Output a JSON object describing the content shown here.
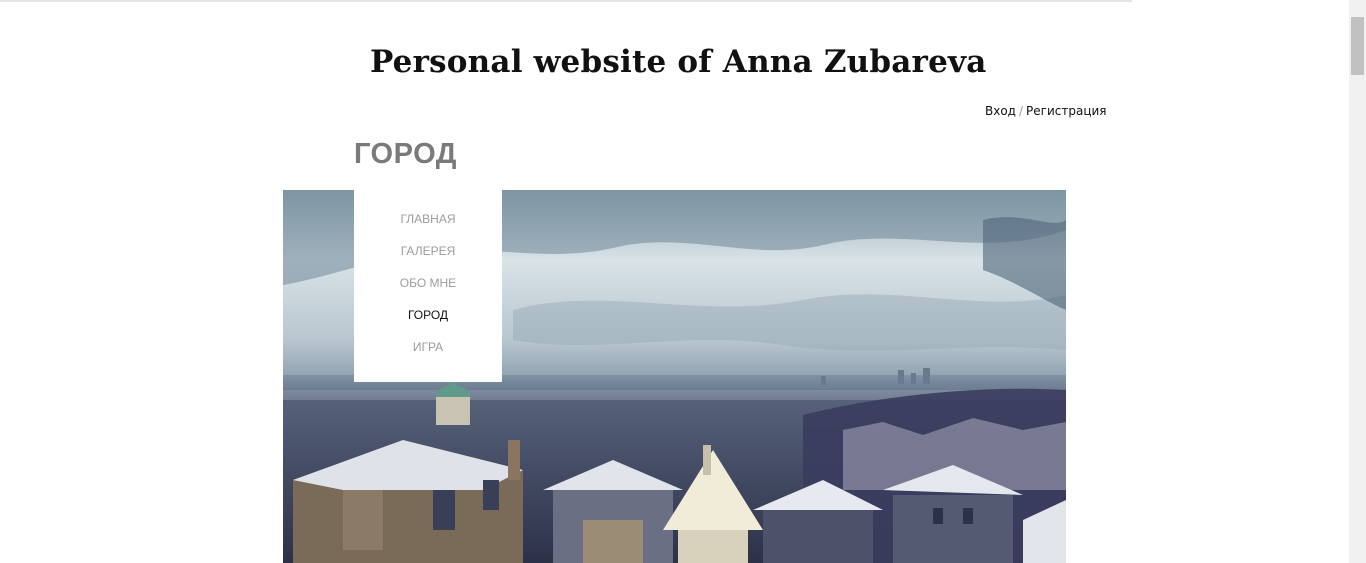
{
  "header": {
    "site_title": "Personal website of Anna Zubareva"
  },
  "auth": {
    "login": "Вход",
    "separator": "/",
    "register": "Регистрация"
  },
  "page": {
    "heading": "ГОРОД"
  },
  "nav": {
    "items": [
      {
        "label": "ГЛАВНАЯ",
        "active": false
      },
      {
        "label": "ГАЛЕРЕЯ",
        "active": false
      },
      {
        "label": "ОБО МНЕ",
        "active": false
      },
      {
        "label": "ГОРОД",
        "active": true
      },
      {
        "label": "ИГРА",
        "active": false
      }
    ]
  },
  "colors": {
    "heading": "#7a7a7a",
    "nav_inactive": "#9c9c9c",
    "nav_active": "#111111",
    "background": "#ffffff"
  }
}
